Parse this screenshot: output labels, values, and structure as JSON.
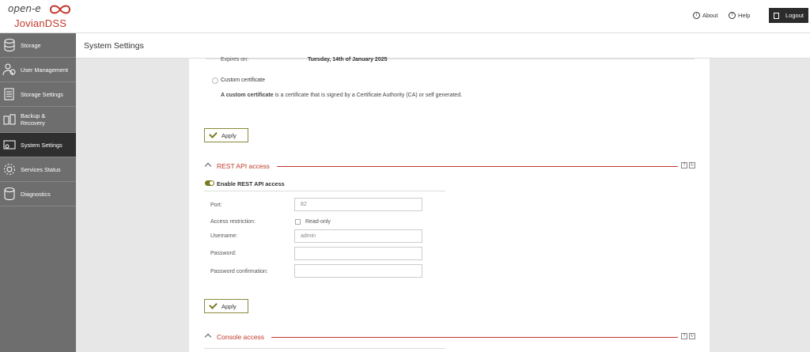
{
  "brand": {
    "line1": "open-e",
    "line2": "JovianDSS"
  },
  "topbar": {
    "about": "About",
    "help": "Help",
    "logout": "Logout"
  },
  "sidebar": {
    "items": [
      {
        "label": "Storage",
        "icon": "storage-icon"
      },
      {
        "label": "User Management",
        "icon": "users-icon"
      },
      {
        "label": "Storage Settings",
        "icon": "storage-settings-icon"
      },
      {
        "label": "Backup & Recovery",
        "icon": "backup-icon"
      },
      {
        "label": "System Settings",
        "icon": "system-settings-icon",
        "active": true
      },
      {
        "label": "Services Status",
        "icon": "gear-icon"
      },
      {
        "label": "Diagnostics",
        "icon": "diagnostics-icon"
      }
    ]
  },
  "page": {
    "title": "System Settings"
  },
  "certificate": {
    "expires_label": "Expires on:",
    "expires_value": "Tuesday, 14th of January 2025",
    "custom_label": "Custom certificate",
    "custom_desc_bold": "A custom certificate",
    "custom_desc_rest": " is a certificate that is signed by a Certificate Authority (CA) or self generated.",
    "apply": "Apply"
  },
  "rest_api": {
    "title": "REST API access",
    "enable_label": "Enable REST API access",
    "port_label": "Port:",
    "port_value": "82",
    "access_label": "Access restriction:",
    "readonly_label": "Read-only",
    "username_label": "Username:",
    "username_value": "admin",
    "password_label": "Password:",
    "password_value": "",
    "confirm_label": "Password confirmation:",
    "confirm_value": "",
    "apply": "Apply"
  },
  "console": {
    "title": "Console access"
  },
  "colors": {
    "accent": "#c0392b",
    "sidebar": "#6e6e6e",
    "active": "#2f2f2f",
    "olive": "#7a7a20"
  }
}
